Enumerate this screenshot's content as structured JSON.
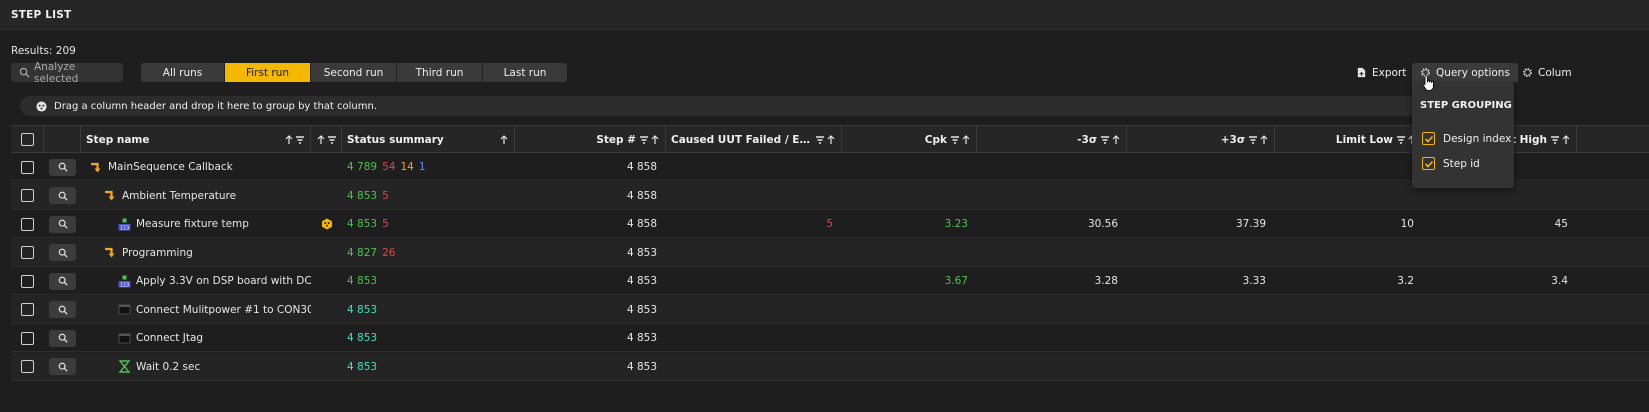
{
  "panel": {
    "title": "STEP LIST"
  },
  "results": {
    "label": "Results: 209"
  },
  "toolbar": {
    "analyze_label": "Analyze selected",
    "runs": [
      "All runs",
      "First run",
      "Second run",
      "Third run",
      "Last run"
    ],
    "active_run": "First run",
    "export_label": "Export",
    "query_options_label": "Query options",
    "columns_label": "Colum"
  },
  "groupbar": {
    "text": "Drag a column header and drop it here to group by that column."
  },
  "columns": {
    "step_name": "Step name",
    "status_summary": "Status summary",
    "step_num": "Step #",
    "caused_uut": "Caused UUT Failed / Error /...",
    "cpk": "Cpk",
    "minus3s": "-3σ",
    "plus3s": "+3σ",
    "limit_low": "Limit Low",
    "limit_high": "t High"
  },
  "rows": [
    {
      "indent": 0,
      "icon": "callback-icon",
      "name": "MainSequence Callback",
      "alert": false,
      "status": [
        {
          "v": "4 789",
          "c": "g"
        },
        {
          "v": "54",
          "c": "r"
        },
        {
          "v": "14",
          "c": "o"
        },
        {
          "v": "1",
          "c": "b"
        }
      ],
      "step": "4 858",
      "caused": "",
      "cpk": "",
      "m3": "",
      "p3": "",
      "ll": "",
      "lh": ""
    },
    {
      "indent": 1,
      "icon": "callback-icon",
      "name": "Ambient Temperature",
      "alert": false,
      "status": [
        {
          "v": "4 853",
          "c": "g"
        },
        {
          "v": "5",
          "c": "r"
        }
      ],
      "step": "4 858",
      "caused": "",
      "cpk": "",
      "m3": "",
      "p3": "",
      "ll": "",
      "lh": ""
    },
    {
      "indent": 2,
      "icon": "numeric-limit-icon",
      "name": "Measure fixture temp",
      "alert": true,
      "status": [
        {
          "v": "4 853",
          "c": "g"
        },
        {
          "v": "5",
          "c": "r"
        }
      ],
      "step": "4 858",
      "caused": "5",
      "cpk": "3.23",
      "m3": "30.56",
      "p3": "37.39",
      "ll": "10",
      "lh": "45"
    },
    {
      "indent": 1,
      "icon": "callback-icon",
      "name": "Programming",
      "alert": false,
      "status": [
        {
          "v": "4 827",
          "c": "g"
        },
        {
          "v": "26",
          "c": "r"
        }
      ],
      "step": "4 853",
      "caused": "",
      "cpk": "",
      "m3": "",
      "p3": "",
      "ll": "",
      "lh": ""
    },
    {
      "indent": 2,
      "icon": "numeric-limit-icon",
      "name": "Apply 3.3V on DSP board with DC ...",
      "alert": false,
      "status": [
        {
          "v": "4 853",
          "c": "g"
        }
      ],
      "step": "4 853",
      "caused": "",
      "cpk": "3.67",
      "m3": "3.28",
      "p3": "3.33",
      "ll": "3.2",
      "lh": "3.4"
    },
    {
      "indent": 2,
      "icon": "action-icon",
      "name": "Connect Mulitpower #1 to CON30...",
      "alert": false,
      "status": [
        {
          "v": "4 853",
          "c": "c"
        }
      ],
      "step": "4 853",
      "caused": "",
      "cpk": "",
      "m3": "",
      "p3": "",
      "ll": "",
      "lh": ""
    },
    {
      "indent": 2,
      "icon": "action-icon",
      "name": "Connect Jtag",
      "alert": false,
      "status": [
        {
          "v": "4 853",
          "c": "c"
        }
      ],
      "step": "4 853",
      "caused": "",
      "cpk": "",
      "m3": "",
      "p3": "",
      "ll": "",
      "lh": ""
    },
    {
      "indent": 2,
      "icon": "hourglass-icon",
      "name": "Wait 0.2 sec",
      "alert": false,
      "status": [
        {
          "v": "4 853",
          "c": "c"
        }
      ],
      "step": "4 853",
      "caused": "",
      "cpk": "",
      "m3": "",
      "p3": "",
      "ll": "",
      "lh": ""
    }
  ],
  "query_popup": {
    "heading": "STEP GROUPING",
    "options": [
      {
        "label": "Design index",
        "checked": true
      },
      {
        "label": "Step id",
        "checked": true
      }
    ]
  },
  "colors": {
    "accent": "#f5b800",
    "pass": "#4fc14f",
    "fail": "#e04848",
    "error": "#f5a623",
    "terminated": "#6b8cff",
    "done": "#3ee0c0"
  }
}
